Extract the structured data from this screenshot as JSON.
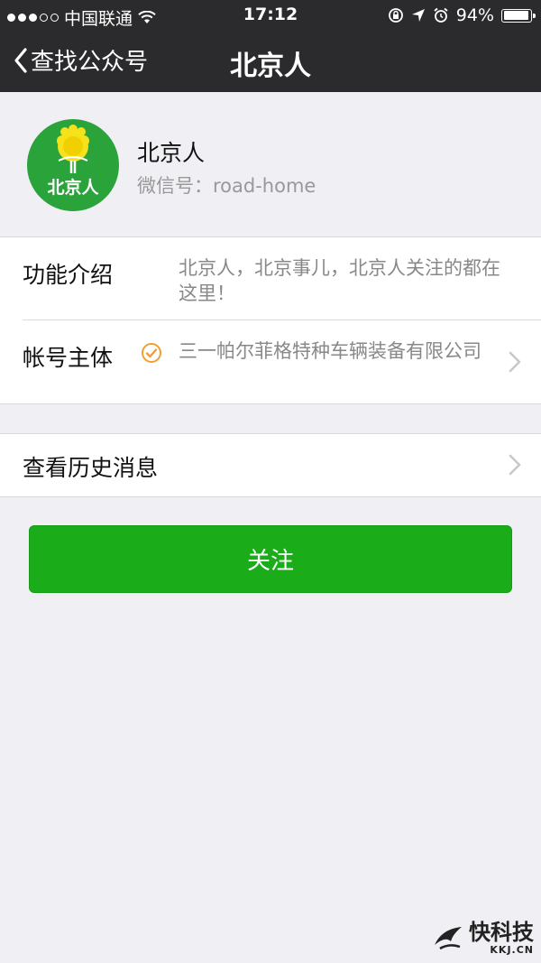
{
  "status_bar": {
    "carrier": "中国联通",
    "time": "17:12",
    "battery": "94%",
    "battery_level": 0.94
  },
  "nav": {
    "back_label": "查找公众号",
    "title": "北京人"
  },
  "account": {
    "logo_text": "北京人",
    "name": "北京人",
    "wechat_id": "微信号：road-home"
  },
  "info": {
    "intro_label": "功能介绍",
    "intro_value": "北京人，北京事儿，北京人关注的都在这里！",
    "entity_label": "帐号主体",
    "entity_value": "三一帕尔菲格特种车辆装备有限公司"
  },
  "history": {
    "label": "查看历史消息"
  },
  "follow_button": "关注",
  "watermark": {
    "main": "快科技",
    "sub": "KKJ.CN"
  },
  "colors": {
    "nav_bg": "#2b2b2d",
    "page_bg": "#efeff4",
    "button_green": "#1aad19",
    "verified_orange": "#f0a030",
    "logo_green": "#2aa33b",
    "logo_yellow": "#f5e21a"
  },
  "icons": {
    "signal": "signal-dots-icon",
    "wifi": "wifi-icon",
    "orientation_lock": "orientation-lock-icon",
    "location": "location-arrow-icon",
    "alarm": "alarm-clock-icon",
    "battery": "battery-icon",
    "back": "chevron-left-icon",
    "verified": "verified-check-icon",
    "disclosure": "chevron-right-icon"
  }
}
